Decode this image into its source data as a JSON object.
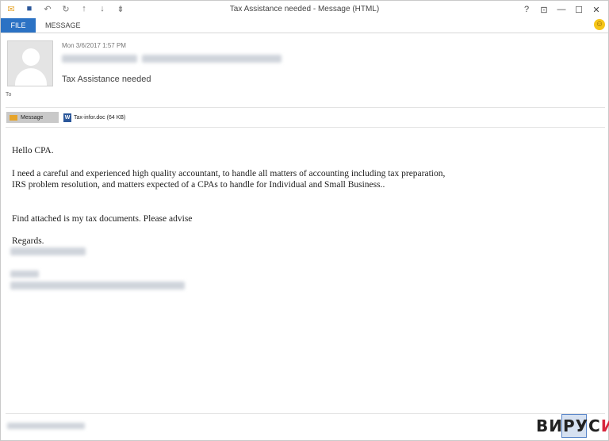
{
  "window": {
    "title": "Tax Assistance needed - Message (HTML)",
    "controls": [
      "?",
      "⊡",
      "—",
      "☐",
      "✕"
    ]
  },
  "quick_access": {
    "icons": [
      "mail-icon",
      "save-icon",
      "undo-icon",
      "redo-icon",
      "up-arrow-icon",
      "down-arrow-icon",
      "customize-icon"
    ]
  },
  "ribbon": {
    "file_tab": "FILE",
    "message_tab": "MESSAGE"
  },
  "header": {
    "date": "Mon 3/6/2017 1:57 PM",
    "subject": "Tax Assistance needed",
    "to_label": "To"
  },
  "attachments": {
    "message_label": "Message",
    "file_label": "Tax-infor.doc (64 KB)"
  },
  "body": {
    "greeting": "Hello CPA.",
    "para1_line1": "I need a careful and experienced high quality accountant, to handle all matters of accounting including tax preparation,",
    "para1_line2": "IRS problem resolution, and matters expected of a CPAs to handle for Individual and Small Business..",
    "para2": "Find attached is my tax documents. Please advise",
    "regards": "Regards."
  },
  "watermark": {
    "text_main": "ВИРУС",
    "text_accent": "И"
  },
  "colors": {
    "file_tab": "#2b72c4",
    "watermark_accent": "#d7263d"
  }
}
